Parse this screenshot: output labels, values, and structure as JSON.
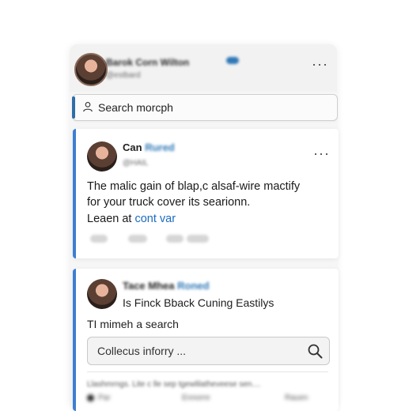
{
  "header": {
    "name": "Barok Corn Wilton",
    "handle": "@estbard"
  },
  "search": {
    "label": "Search morcph"
  },
  "post1": {
    "author_name": "Can",
    "author_highlight": "Rured",
    "handle": "@HAIL",
    "text_line1": "The malic gain of blap,c alsaf-wire mactify",
    "text_line2": "for your truck cover its searionn.",
    "link_prefix": "Leaen at ",
    "link_text": "cont var"
  },
  "post2": {
    "author_name": "Tace Mhea",
    "author_highlight": "Roned",
    "title": "Is Finck Bback Cuning Eastilys",
    "subtitle": "TI mimeh a search",
    "search_placeholder": "Collecus inforry ...",
    "footer_text": "Llashmrngs. Lite c lle sep tgewlilatheveese sen....",
    "footer_a": "Par",
    "footer_b": "Ennorre",
    "footer_c": "Rauen"
  },
  "colors": {
    "accent": "#2f78b7",
    "card_border": "#3c7fd1",
    "link": "#1c6cc0"
  },
  "icons": {
    "more": "more-horizontal-icon",
    "user": "user-icon",
    "search": "search-icon"
  }
}
